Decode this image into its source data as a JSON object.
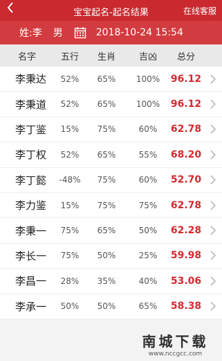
{
  "header": {
    "back_icon": "chevron-left",
    "title": "宝宝起名-起名结果",
    "service": "在线客服"
  },
  "info": {
    "surname": "姓:李",
    "gender": "男",
    "calendar_icon": "calendar",
    "datetime": "2018-10-24 15:54"
  },
  "columns": {
    "name": "名字",
    "wuxing": "五行",
    "shengxiao": "生肖",
    "jixiong": "吉凶",
    "score": "总分"
  },
  "rows": [
    {
      "name": "李秉达",
      "wuxing": "52%",
      "shengxiao": "65%",
      "jixiong": "100%",
      "score": "96.12"
    },
    {
      "name": "李秉道",
      "wuxing": "52%",
      "shengxiao": "65%",
      "jixiong": "100%",
      "score": "96.12"
    },
    {
      "name": "李丁鉴",
      "wuxing": "15%",
      "shengxiao": "75%",
      "jixiong": "60%",
      "score": "62.78"
    },
    {
      "name": "李丁权",
      "wuxing": "52%",
      "shengxiao": "65%",
      "jixiong": "55%",
      "score": "68.20"
    },
    {
      "name": "李丁懿",
      "wuxing": "-48%",
      "shengxiao": "75%",
      "jixiong": "60%",
      "score": "52.70"
    },
    {
      "name": "李力鉴",
      "wuxing": "15%",
      "shengxiao": "75%",
      "jixiong": "75%",
      "score": "62.78"
    },
    {
      "name": "李秉一",
      "wuxing": "75%",
      "shengxiao": "65%",
      "jixiong": "50%",
      "score": "62.28"
    },
    {
      "name": "李长一",
      "wuxing": "75%",
      "shengxiao": "50%",
      "jixiong": "25%",
      "score": "59.98"
    },
    {
      "name": "李昌一",
      "wuxing": "28%",
      "shengxiao": "35%",
      "jixiong": "40%",
      "score": "53.06"
    },
    {
      "name": "李承一",
      "wuxing": "50%",
      "shengxiao": "50%",
      "jixiong": "65%",
      "score": "58.38"
    }
  ],
  "watermark": {
    "main": "南城下载",
    "url": "www.nccgcc.com"
  },
  "colors": {
    "topbar": "#c9292f",
    "infobar": "#d23b3f",
    "score": "#d32a2f"
  }
}
